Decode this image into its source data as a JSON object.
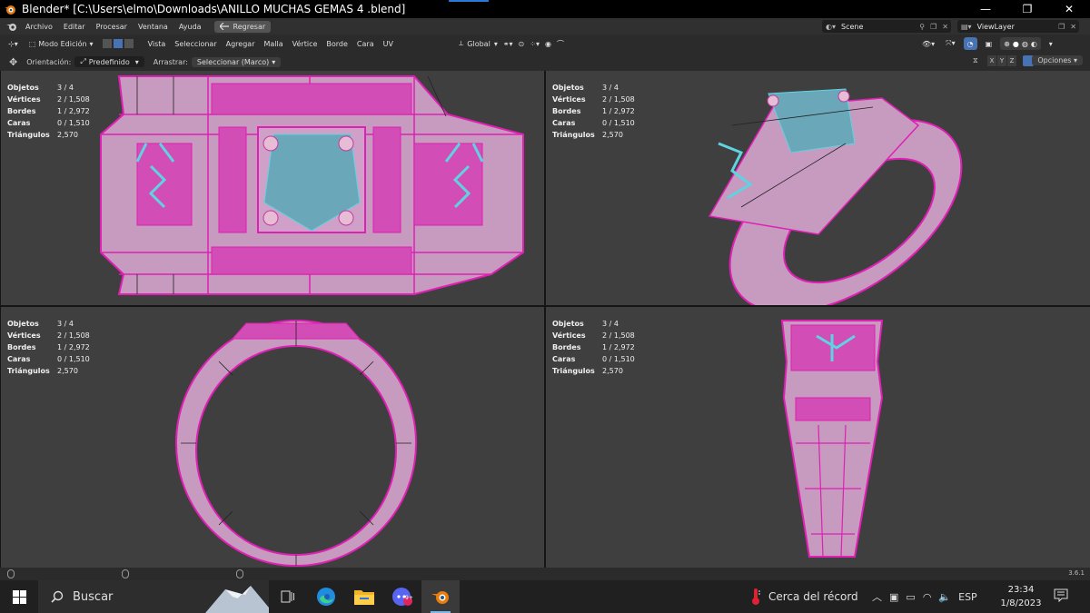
{
  "titlebar": {
    "title": "Blender* [C:\\Users\\elmo\\Downloads\\ANILLO MUCHAS GEMAS 4 .blend]",
    "minimize": "—",
    "restore": "❐",
    "close": "✕"
  },
  "menubar": {
    "items": [
      "Archivo",
      "Editar",
      "Procesar",
      "Ventana",
      "Ayuda"
    ],
    "back_button": "Regresar",
    "scene": "Scene",
    "view_layer": "ViewLayer"
  },
  "header": {
    "mode": "Modo Edición",
    "menus": [
      "Vista",
      "Seleccionar",
      "Agregar",
      "Malla",
      "Vértice",
      "Borde",
      "Cara",
      "UV"
    ],
    "transform_orientation": "Global"
  },
  "toolrow": {
    "orientation_label": "Orientación:",
    "orientation_value": "Predefinido",
    "drag_label": "Arrastrar:",
    "drag_value": "Seleccionar (Marco)",
    "axes": [
      "X",
      "Y",
      "Z"
    ],
    "options": "Opciones"
  },
  "viewport_stats": {
    "rows": [
      {
        "label": "Objetos",
        "value": "3 / 4"
      },
      {
        "label": "Vértices",
        "value": "2 / 1,508"
      },
      {
        "label": "Bordes",
        "value": "1 / 2,972"
      },
      {
        "label": "Caras",
        "value": "0 / 1,510"
      },
      {
        "label": "Triángulos",
        "value": "2,570"
      }
    ]
  },
  "statusbar": {
    "version": "3.6.1"
  },
  "taskbar": {
    "search_placeholder": "Buscar",
    "weather_text": "Cerca del récord",
    "language": "ESP",
    "time": "23:34",
    "date": "1/8/2023",
    "notification_badge": "9+"
  },
  "colors": {
    "mesh_fill": "#c79ac0",
    "mesh_edge": "#e01fb4",
    "gem_cyan": "#5fd3e0",
    "viewport_bg": "#3f3f3f"
  }
}
